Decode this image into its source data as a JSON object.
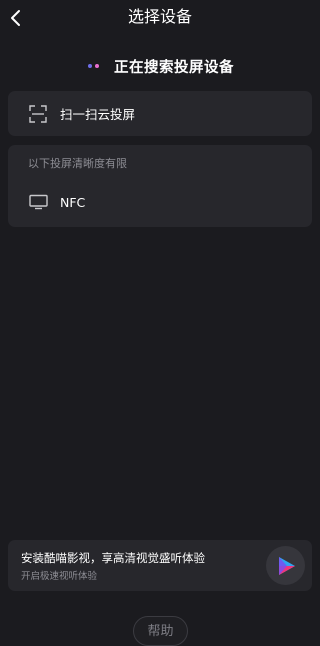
{
  "header": {
    "title": "选择设备",
    "back_icon": "chevron-left-icon"
  },
  "status": {
    "text": "正在搜索投屏设备",
    "dot_colors": [
      "#6e6ee8",
      "#e86ecf"
    ]
  },
  "scan": {
    "label": "扫一扫云投屏",
    "icon": "scan-icon"
  },
  "device_list": {
    "header": "以下投屏清晰度有限",
    "devices": [
      {
        "name": "NFC",
        "icon": "tv-icon"
      }
    ]
  },
  "promo": {
    "title": "安装酷喵影视，享高清视觉盛听体验",
    "subtitle": "开启极速视听体验",
    "logo_icon": "cool-miao-app-logo"
  },
  "help": {
    "label": "帮助"
  },
  "colors": {
    "background": "#1b1b1f",
    "card": "#27272c",
    "secondary_text": "#8d8d94"
  }
}
